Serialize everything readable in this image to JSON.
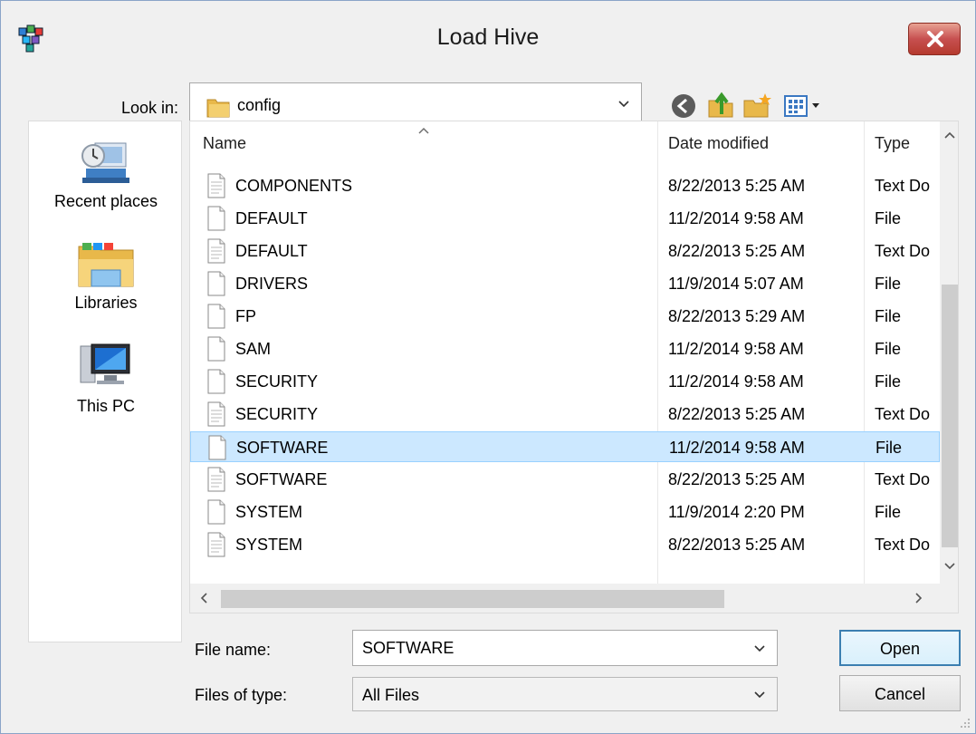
{
  "window": {
    "title": "Load Hive"
  },
  "lookin": {
    "label": "Look in:",
    "value": "config"
  },
  "places": [
    {
      "label": "Recent places",
      "icon": "recent-places-icon"
    },
    {
      "label": "Libraries",
      "icon": "libraries-icon"
    },
    {
      "label": "This PC",
      "icon": "this-pc-icon"
    }
  ],
  "columns": {
    "name": "Name",
    "date": "Date modified",
    "type": "Type"
  },
  "files": [
    {
      "name": "COMPONENTS",
      "date": "8/22/2013 5:25 AM",
      "type": "Text Do"
    },
    {
      "name": "DEFAULT",
      "date": "11/2/2014 9:58 AM",
      "type": "File"
    },
    {
      "name": "DEFAULT",
      "date": "8/22/2013 5:25 AM",
      "type": "Text Do"
    },
    {
      "name": "DRIVERS",
      "date": "11/9/2014 5:07 AM",
      "type": "File"
    },
    {
      "name": "FP",
      "date": "8/22/2013 5:29 AM",
      "type": "File"
    },
    {
      "name": "SAM",
      "date": "11/2/2014 9:58 AM",
      "type": "File"
    },
    {
      "name": "SECURITY",
      "date": "11/2/2014 9:58 AM",
      "type": "File"
    },
    {
      "name": "SECURITY",
      "date": "8/22/2013 5:25 AM",
      "type": "Text Do"
    },
    {
      "name": "SOFTWARE",
      "date": "11/2/2014 9:58 AM",
      "type": "File",
      "selected": true
    },
    {
      "name": "SOFTWARE",
      "date": "8/22/2013 5:25 AM",
      "type": "Text Do"
    },
    {
      "name": "SYSTEM",
      "date": "11/9/2014 2:20 PM",
      "type": "File"
    },
    {
      "name": "SYSTEM",
      "date": "8/22/2013 5:25 AM",
      "type": "Text Do"
    }
  ],
  "filename": {
    "label": "File name:",
    "value": "SOFTWARE"
  },
  "filetype": {
    "label": "Files of type:",
    "value": "All Files"
  },
  "buttons": {
    "open": "Open",
    "cancel": "Cancel"
  },
  "colors": {
    "selection": "#cce8ff",
    "selection_border": "#99d1ff",
    "close": "#c75050",
    "default_button_border": "#3c7fb1"
  }
}
